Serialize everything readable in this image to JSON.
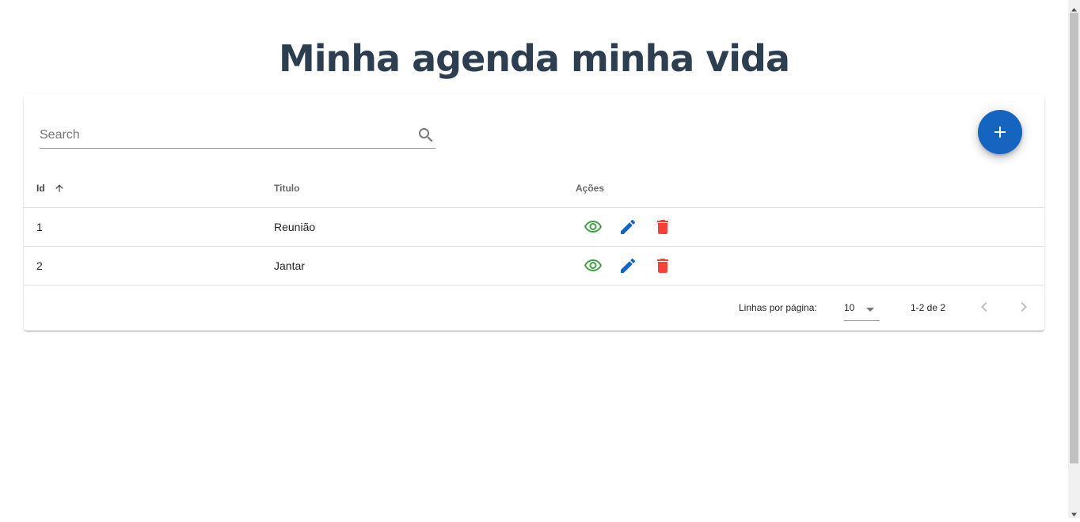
{
  "page": {
    "title": "Minha agenda minha vida"
  },
  "search": {
    "placeholder": "Search"
  },
  "table": {
    "columns": {
      "id": "Id",
      "title": "Titulo",
      "actions": "Ações"
    },
    "sort": {
      "column": "id",
      "direction": "ascending"
    },
    "rows": [
      {
        "id": "1",
        "title": "Reunião"
      },
      {
        "id": "2",
        "title": "Jantar"
      }
    ],
    "action_icons": [
      "eye-icon",
      "pencil-icon",
      "trash-icon"
    ]
  },
  "pagination": {
    "rows_per_page_label": "Linhas por página:",
    "rows_per_page": "10",
    "range": "1-2 de 2"
  },
  "colors": {
    "title": "#2c3e50",
    "primary": "#1565c0",
    "view": "#43a047",
    "delete": "#f44336"
  }
}
